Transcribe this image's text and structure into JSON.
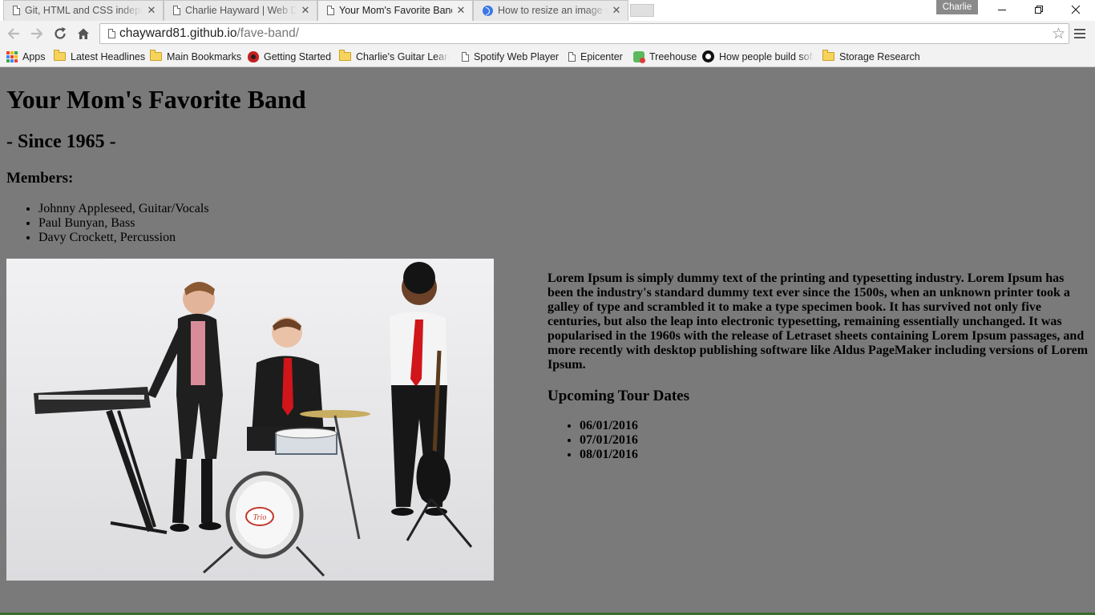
{
  "browser": {
    "profile_name": "Charlie",
    "tabs": [
      {
        "title": "Git, HTML and CSS indepe",
        "icon": "document-icon",
        "active": false
      },
      {
        "title": "Charlie Hayward | Web De",
        "icon": "document-icon",
        "active": false
      },
      {
        "title": "Your Mom's Favorite Band",
        "icon": "document-icon",
        "active": true
      },
      {
        "title": "How to resize an image w",
        "icon": "globe-icon",
        "active": false
      }
    ],
    "close_glyph": "✕",
    "url_host": "chayward81.github.io",
    "url_path": "/fave-band/",
    "bookmarks": [
      {
        "label": "Apps",
        "icon": "apps-icon"
      },
      {
        "label": "Latest Headlines",
        "icon": "folder-icon"
      },
      {
        "label": "Main Bookmarks",
        "icon": "folder-icon"
      },
      {
        "label": "Getting Started",
        "icon": "flame-icon"
      },
      {
        "label": "Charlie's Guitar Learni",
        "icon": "folder-icon"
      },
      {
        "label": "Spotify Web Player",
        "icon": "document-icon"
      },
      {
        "label": "Epicenter",
        "icon": "document-icon"
      },
      {
        "label": "Treehouse",
        "icon": "treehouse-icon"
      },
      {
        "label": "How people build soft",
        "icon": "github-icon"
      },
      {
        "label": "Storage Research",
        "icon": "folder-icon"
      }
    ]
  },
  "page": {
    "background_color": "#7a7a7a",
    "title": "Your Mom's Favorite Band",
    "since": "- Since 1965 -",
    "members_heading": "Members:",
    "members": [
      "Johnny Appleseed, Guitar/Vocals",
      "Paul Bunyan, Bass",
      "Davy Crockett, Percussion"
    ],
    "drum_logo": "Trio",
    "lorem": "Lorem Ipsum is simply dummy text of the printing and typesetting industry. Lorem Ipsum has been the industry's standard dummy text ever since the 1500s, when an unknown printer took a galley of type and scrambled it to make a type specimen book. It has survived not only five centuries, but also the leap into electronic typesetting, remaining essentially unchanged. It was popularised in the 1960s with the release of Letraset sheets containing Lorem Ipsum passages, and more recently with desktop publishing software like Aldus PageMaker including versions of Lorem Ipsum.",
    "tour_heading": "Upcoming Tour Dates",
    "tour_dates": [
      "06/01/2016",
      "07/01/2016",
      "08/01/2016"
    ]
  }
}
